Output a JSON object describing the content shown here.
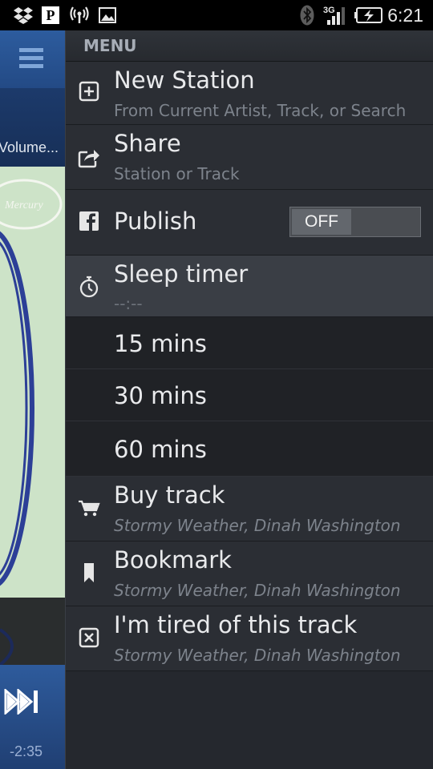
{
  "status_bar": {
    "time": "6:21",
    "network": "3G"
  },
  "left_panel": {
    "title": "Volume...",
    "time_remaining": "-2:35",
    "label_stamp": "Mercury"
  },
  "menu": {
    "header": "MENU",
    "new_station": {
      "title": "New Station",
      "subtitle": "From Current Artist, Track, or Search"
    },
    "share": {
      "title": "Share",
      "subtitle": "Station or Track"
    },
    "publish": {
      "title": "Publish",
      "toggle": "OFF"
    },
    "sleep_timer": {
      "title": "Sleep timer",
      "subtitle": "--:--"
    },
    "sleep_options": [
      "15 mins",
      "30 mins",
      "60 mins"
    ],
    "buy_track": {
      "title": "Buy track",
      "subtitle": "Stormy Weather, Dinah Washington"
    },
    "bookmark": {
      "title": "Bookmark",
      "subtitle": "Stormy Weather, Dinah Washington"
    },
    "tired": {
      "title": "I'm tired of this track",
      "subtitle": "Stormy Weather, Dinah Washington"
    }
  },
  "colors": {
    "accent": "#2d5c9e",
    "menu_bg": "#25282e",
    "row_bg": "#2b2e34",
    "active_row": "#3a3e45"
  }
}
